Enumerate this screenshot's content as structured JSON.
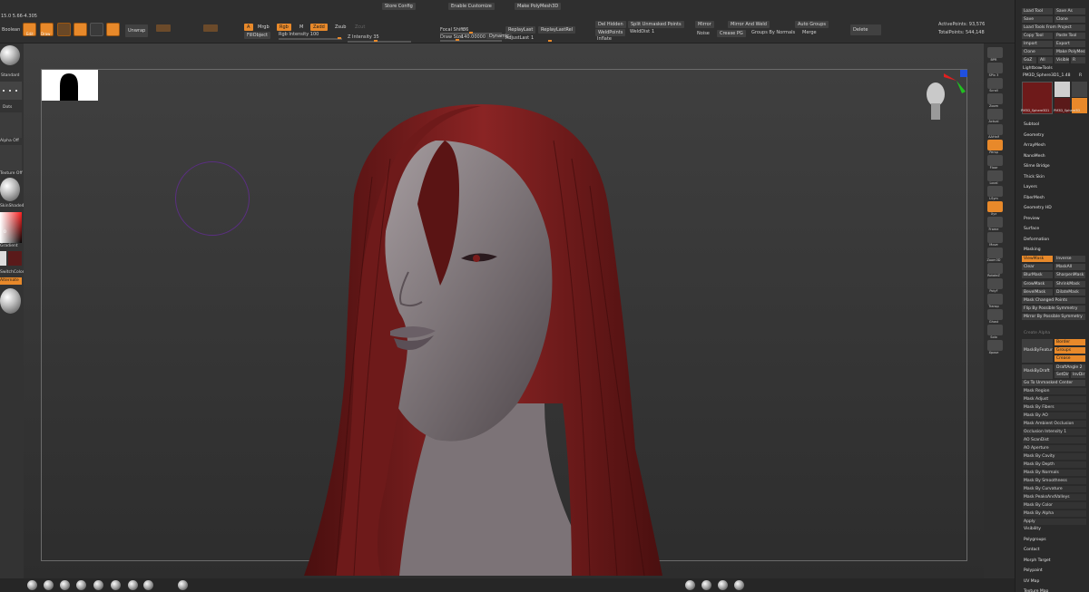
{
  "topbar": {
    "left_labels": [
      "15.0 5.66-4.305",
      "Boolean"
    ],
    "tool_labels": [
      "Edit",
      "Draw",
      "Move",
      "Scale",
      "Rotate"
    ],
    "unwrap_label": "Unwrap",
    "buttons": {
      "store_config": "Store Config",
      "enable_customize": "Enable Customize",
      "make_polymesh": "Make PolyMesh3D",
      "mrgb": "Mrgb",
      "rgb": "Rgb",
      "m": "M",
      "zadd": "Zadd",
      "zsub": "Zsub",
      "zcut": "Zcut",
      "fillobject": "FillObject",
      "focal_shift_label": "Focal Shift",
      "focal_shift_value": "86",
      "draw_size_label": "Draw Size",
      "draw_size_value": "140.00000",
      "dynamic": "Dynamic",
      "replay_last": "ReplayLast",
      "replay_last_rel": "ReplayLastRel",
      "adjust_last_label": "AdjustLast",
      "adjust_last_value": "1",
      "del_hidden": "Del Hidden",
      "split_unmasked": "Split Unmasked Points",
      "weld_points": "WeldPoints",
      "weld_dist_label": "WeldDist",
      "weld_dist_value": "1",
      "inflate": "Inflate",
      "noise": "Noise",
      "crease_pg": "Crease PG",
      "mirror": "Mirror",
      "mirror_and_weld": "Mirror And Weld",
      "groups_by_normals": "Groups By Normals",
      "auto_groups": "Auto Groups",
      "merge": "Merge",
      "delete": "Delete",
      "rgb_intensity": "Rgb Intensity 100",
      "z_intensity": "Z Intensity 35",
      "active_points": "ActivePoints: 93,576",
      "total_points": "TotalPoints: 544,148"
    }
  },
  "left_shelf": {
    "labels": [
      "Standard",
      "Dots",
      "Alpha Off",
      "Texture Off",
      "SkinShade4",
      "Gradient",
      "SwitchColor",
      "Alternate"
    ],
    "color_value": "0"
  },
  "viewport": {
    "gyro_colors": [
      "#e02020",
      "#20c020",
      "#2050e0"
    ]
  },
  "right_shelf": {
    "items": [
      "BPR",
      "SPix 3",
      "Scroll",
      "Zoom",
      "Actual",
      "AAHalf",
      "Persp",
      "Floor",
      "Local",
      "LSym",
      "Xyz",
      "Frame",
      "Move",
      "Zoom3D",
      "RotateZ",
      "PolyF",
      "Transp",
      "Ghost",
      "Solo",
      "Xpose"
    ],
    "orange": [
      "Persp",
      "Xyz"
    ]
  },
  "tray": {
    "top_buttons": [
      [
        "Load Tool",
        "Save As"
      ],
      [
        "Save",
        "Clone"
      ],
      [
        "Load Tools From Project"
      ],
      [
        "Copy Tool",
        "Paste Tool"
      ],
      [
        "Import",
        "Export"
      ],
      [
        "Clone",
        "Make PolyMesh3D"
      ],
      [
        "GoZ",
        "All",
        "Visible",
        "R"
      ]
    ],
    "lightbox_label": "Lightbox▸Tools",
    "current_tool_label": "PM3D_Sphere3D1_1.48",
    "r_button": "R",
    "tool_thumbs": [
      "PM3D_Sphere3D1",
      "Cylinder PolyMe",
      "PM3D_Sphere3D",
      "SimpleBrush"
    ],
    "menus": [
      "Subtool",
      "Geometry",
      "ArrayMesh",
      "NanoMesh",
      "Slime Bridge",
      "Thick Skin",
      "Layers",
      "FiberMesh",
      "Geometry HD",
      "Preview",
      "Surface",
      "Deformation",
      "Masking"
    ],
    "masking_rows": [
      [
        "ViewMask",
        "Inverse"
      ],
      [
        "Clear",
        "MaskAll"
      ],
      [
        "BlurMask",
        "SharpenMask"
      ],
      [
        "GrowMask",
        "ShrinkMask"
      ],
      [
        "BevelMask",
        "DilateMask"
      ],
      [
        "Mask Changed Points"
      ],
      [
        "Flip By Possible Symmetry"
      ],
      [
        "Mirror By Possible Symmetry"
      ]
    ],
    "create_alpha": "Create Alpha",
    "mask_by_feature": "MaskByFeature",
    "feature_opts": [
      "Border",
      "Groups",
      "Crease"
    ],
    "mask_by_draft": "MaskByDraft",
    "draft_angle": "DraftAngle 2",
    "set_dir": "SetDir",
    "inv_dir": "InvDir",
    "go_to_unmasked": "Go To Unmasked Center",
    "mask_list": [
      "Mask Region",
      "Mask Adjust",
      "Mask By Fibers",
      "Mask By AO",
      "Mask Ambient Occlusion",
      "Occlusion Intensity 1",
      "AO ScanDist",
      "AO Aperture",
      "Mask By Cavity",
      "Mask By Depth",
      "Mask By Normals",
      "Mask By Smoothness",
      "Mask By Curvature",
      "Mask PeaksAndValleys",
      "Mask By Color",
      "Mask By Alpha",
      "Apply"
    ],
    "bottom_menus": [
      "Visibility",
      "Polygroups",
      "Contact",
      "Morph Target",
      "Polypaint",
      "UV Map",
      "Texture Map"
    ]
  },
  "colors": {
    "accent": "#e8892a",
    "hair": "#7a1f1f",
    "skin": "#8f8285",
    "frame": "#6b6b6b"
  }
}
